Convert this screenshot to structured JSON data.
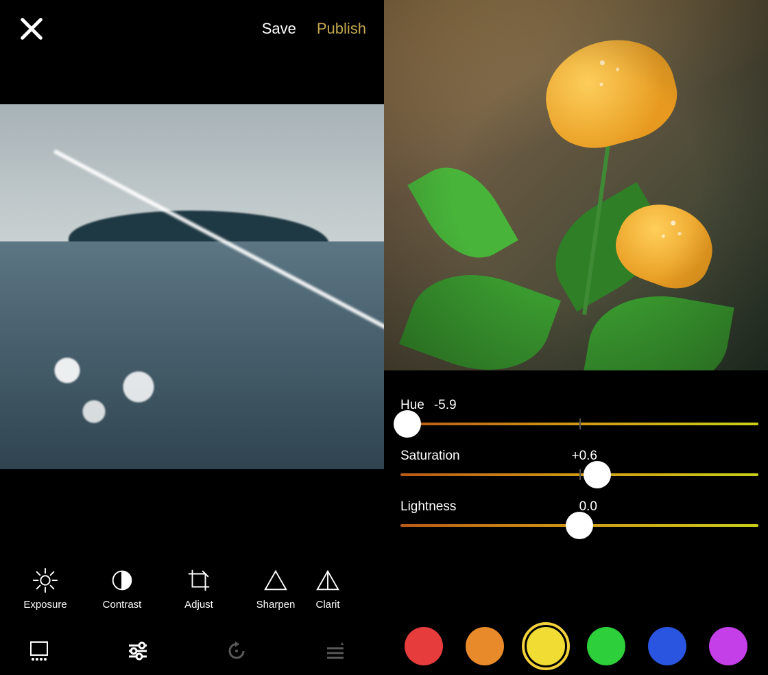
{
  "left": {
    "actions": {
      "save": "Save",
      "publish": "Publish"
    },
    "tools": [
      {
        "id": "exposure",
        "label": "Exposure",
        "icon": "sun-icon"
      },
      {
        "id": "contrast",
        "label": "Contrast",
        "icon": "contrast-icon"
      },
      {
        "id": "adjust",
        "label": "Adjust",
        "icon": "crop-icon"
      },
      {
        "id": "sharpen",
        "label": "Sharpen",
        "icon": "triangle-icon"
      },
      {
        "id": "clarity",
        "label": "Clarit",
        "icon": "triangle-flip-icon"
      }
    ],
    "bottom_tabs": [
      {
        "id": "preset",
        "icon": "preset-icon",
        "active": true
      },
      {
        "id": "sliders",
        "icon": "sliders-icon",
        "active": true
      },
      {
        "id": "reset",
        "icon": "reset-icon",
        "active": false
      },
      {
        "id": "effects",
        "icon": "effects-icon",
        "active": false
      }
    ]
  },
  "right": {
    "sliders": [
      {
        "id": "hue",
        "label": "Hue",
        "value_text": "-5.9",
        "value": -5.9,
        "min": -6,
        "max": 6,
        "thumb_pct": 2
      },
      {
        "id": "saturation",
        "label": "Saturation",
        "value_text": "+0.6",
        "value": 0.6,
        "min": -6,
        "max": 6,
        "thumb_pct": 55
      },
      {
        "id": "lightness",
        "label": "Lightness",
        "value_text": "0.0",
        "value": 0.0,
        "min": -6,
        "max": 6,
        "thumb_pct": 50
      }
    ],
    "swatches": [
      {
        "id": "red",
        "hex": "#e73c3c",
        "selected": false
      },
      {
        "id": "orange",
        "hex": "#e88a2a",
        "selected": false
      },
      {
        "id": "yellow",
        "hex": "#f0dc32",
        "selected": true
      },
      {
        "id": "green",
        "hex": "#2dcf3b",
        "selected": false
      },
      {
        "id": "blue",
        "hex": "#2a55e0",
        "selected": false
      },
      {
        "id": "magenta",
        "hex": "#c53fe8",
        "selected": false
      }
    ]
  }
}
